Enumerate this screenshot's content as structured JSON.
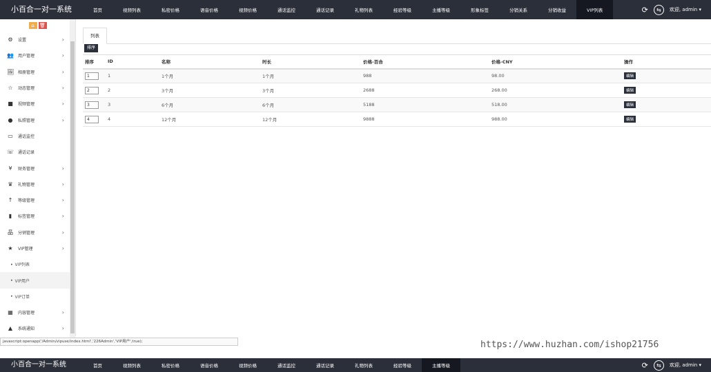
{
  "app": {
    "title": "小百合一对一系统"
  },
  "nav": {
    "items": [
      "首页",
      "视频列表",
      "私密价格",
      "语音价格",
      "视频价格",
      "通话监控",
      "通话记录",
      "礼物列表",
      "经验等级",
      "主播等级",
      "形象标签",
      "分销关系",
      "分销收益",
      "VIP列表"
    ],
    "active_index": 13
  },
  "bottom_nav": {
    "items": [
      "首页",
      "视频列表",
      "私密价格",
      "语音价格",
      "视频价格",
      "通话监控",
      "通话记录",
      "礼物列表",
      "经验等级",
      "主播等级"
    ],
    "active_index": 9
  },
  "user": {
    "greeting": "欢迎, admin",
    "caret": "▾"
  },
  "icons": {
    "refresh": "refresh-icon",
    "user": "user-circle-icon",
    "home": "home-icon",
    "trash": "trash-icon",
    "chevron": "chevron-right-icon"
  },
  "sidebar": {
    "tools": [
      "⌂",
      "🗑"
    ],
    "items": [
      {
        "label": "设置",
        "icon": "⚙",
        "chevron": true
      },
      {
        "label": "用户管理",
        "icon": "👥",
        "chevron": true
      },
      {
        "label": "相册管理",
        "icon": "🖼",
        "chevron": true
      },
      {
        "label": "动态管理",
        "icon": "☆",
        "chevron": true
      },
      {
        "label": "视频管理",
        "icon": "■",
        "chevron": true
      },
      {
        "label": "私照管理",
        "icon": "●",
        "chevron": true
      },
      {
        "label": "通话监控",
        "icon": "▭",
        "chevron": false
      },
      {
        "label": "通话记录",
        "icon": "☏",
        "chevron": false
      },
      {
        "label": "财务管理",
        "icon": "¥",
        "chevron": true
      },
      {
        "label": "礼物管理",
        "icon": "♛",
        "chevron": true
      },
      {
        "label": "等级管理",
        "icon": "↑",
        "chevron": true
      },
      {
        "label": "标签管理",
        "icon": "▮",
        "chevron": true
      },
      {
        "label": "分销管理",
        "icon": "品",
        "chevron": true
      },
      {
        "label": "VIP管理",
        "icon": "★",
        "chevron": true
      },
      {
        "label": "VIP列表",
        "icon": "▸",
        "sub": true
      },
      {
        "label": "VIP用户",
        "icon": "▸",
        "sub": true,
        "active": true
      },
      {
        "label": "VIP订单",
        "icon": "▸",
        "sub": true
      },
      {
        "label": "内容管理",
        "icon": "▦",
        "chevron": true
      },
      {
        "label": "系统通知",
        "icon": "▲",
        "chevron": true
      }
    ]
  },
  "main": {
    "tab_label": "列表",
    "sort_button": "排序",
    "columns": [
      "排序",
      "ID",
      "名称",
      "时长",
      "价格-百合",
      "价格-CNY",
      "操作"
    ],
    "edit_label": "编辑",
    "rows": [
      {
        "sort": "1",
        "id": "1",
        "name": "1个月",
        "duration": "1个月",
        "price_lily": "988",
        "price_cny": "98.00"
      },
      {
        "sort": "2",
        "id": "2",
        "name": "3个月",
        "duration": "3个月",
        "price_lily": "2688",
        "price_cny": "268.00"
      },
      {
        "sort": "3",
        "id": "3",
        "name": "6个月",
        "duration": "6个月",
        "price_lily": "5188",
        "price_cny": "518.00"
      },
      {
        "sort": "4",
        "id": "4",
        "name": "12个月",
        "duration": "12个月",
        "price_lily": "9888",
        "price_cny": "988.00"
      }
    ]
  },
  "statusbar": {
    "text": "javascript:openapp('/Admin/vipuse/index.html','226Admin','VIP用户',true);"
  },
  "watermark": {
    "text": "https://www.huzhan.com/ishop21756"
  }
}
